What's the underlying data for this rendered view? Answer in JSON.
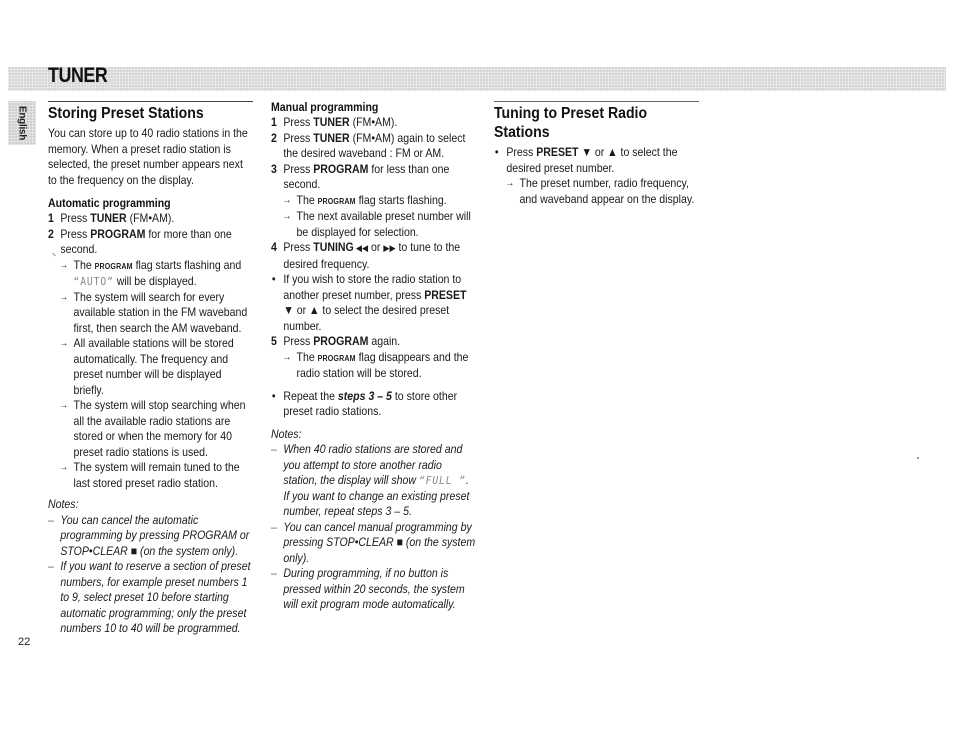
{
  "header": {
    "title": "TUNER",
    "language_tab": "English"
  },
  "page_number": "22",
  "storing": {
    "title": "Storing Preset Stations",
    "intro": "You can store up to 40 radio stations in the memory. When a preset radio station is selected, the preset number appears next to the frequency on the display.",
    "auto": {
      "title": "Automatic programming",
      "step1": {
        "num": "1",
        "pre": "Press ",
        "bold": "TUNER",
        "post": " (FM•AM)."
      },
      "step2": {
        "num": "2",
        "pre": "Press ",
        "bold": "PROGRAM",
        "post": " for more than one second."
      },
      "results": [
        {
          "pre": "The ",
          "flag": "PROGRAM",
          "mid": " flag starts flashing and ",
          "lcd": "“AUTO”",
          "post": " will be displayed."
        },
        {
          "text": "The system will search for every available station in the FM waveband first, then search the AM waveband."
        },
        {
          "text": "All available stations will be stored automatically. The frequency and preset number will be displayed briefly."
        },
        {
          "text": "The system  will stop searching when all the available radio stations are stored or when the memory for 40 preset radio stations is used."
        },
        {
          "text": "The system will remain tuned to the last stored preset radio station."
        }
      ],
      "notes_label": "Notes:",
      "notes": [
        {
          "pre": "You can cancel the automatic programming by pressing PROGRAM or STOP•CLEAR ",
          "symbol": "■",
          "post": " (on the system only)."
        },
        {
          "pre": "If you want to reserve a section of preset numbers, for example preset numbers 1 to 9, select preset 10 before starting automatic programming; only the preset numbers 10 to 40 will be programmed.",
          "symbol": "",
          "post": ""
        }
      ]
    }
  },
  "manual": {
    "title": "Manual programming",
    "step1": {
      "num": "1",
      "pre": "Press ",
      "bold": "TUNER",
      "post": " (FM•AM)."
    },
    "step2": {
      "num": "2",
      "pre": "Press ",
      "bold": "TUNER",
      "post": " (FM•AM) again to select the desired waveband : FM or AM."
    },
    "step3": {
      "num": "3",
      "pre": "Press ",
      "bold": "PROGRAM",
      "post": " for less than one second."
    },
    "step3_results": [
      {
        "pre": "The ",
        "flag": "PROGRAM",
        "post": " flag starts flashing."
      },
      {
        "text": "The next available preset number will be displayed for selection."
      }
    ],
    "step4": {
      "num": "4",
      "pre": "Press ",
      "bold": "TUNING",
      "sym1": " ◀◀",
      "mid": " or ",
      "sym2": "▶▶",
      "post": " to tune to the desired frequency."
    },
    "bullet1": {
      "pre": "If you wish to store the radio station to another preset number, press ",
      "bold": "PRESET",
      "post": " ▼ or ▲ to select the desired preset number."
    },
    "step5": {
      "num": "5",
      "pre": "Press ",
      "bold": "PROGRAM",
      "post": " again."
    },
    "step5_result": {
      "pre": "The ",
      "flag": "PROGRAM",
      "post": " flag disappears and the radio station will be stored."
    },
    "bullet2": {
      "pre": "Repeat the ",
      "bold": "steps 3 – 5",
      "post": " to store other preset radio stations."
    },
    "notes_label": "Notes:",
    "notes": [
      {
        "pre": "When 40 radio stations are stored and you attempt to store another radio station, the display will show ",
        "lcd": "“FULL ”",
        "post": ". If you want to change an existing preset number, repeat steps 3 – 5."
      },
      {
        "pre": "You can cancel manual programming by pressing  STOP•CLEAR ",
        "lcd": "■",
        "post": " (on the system only)."
      },
      {
        "pre": "During programming,  if no button is pressed within 20 seconds, the system will exit program mode automatically.",
        "lcd": "",
        "post": ""
      }
    ]
  },
  "tuning": {
    "title": "Tuning to Preset Radio Stations",
    "bullet": {
      "pre": "Press ",
      "bold": "PRESET",
      "post": " ▼ or ▲ to select the desired preset number."
    },
    "result": "The preset number, radio frequency, and waveband appear on the display."
  },
  "glyphs": {
    "arrow": "→",
    "bullet": "•",
    "dash": "–"
  }
}
